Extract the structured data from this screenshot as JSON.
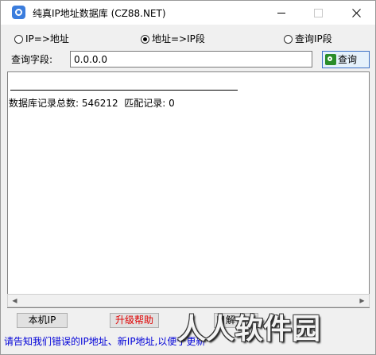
{
  "window": {
    "title": "纯真IP地址数据库  (CZ88.NET)",
    "icon": "app-search-icon"
  },
  "modes": [
    {
      "label": "IP=>地址",
      "checked": false
    },
    {
      "label": "地址=>IP段",
      "checked": true
    },
    {
      "label": "查询IP段",
      "checked": false
    }
  ],
  "query": {
    "label": "查询字段:",
    "value": "0.0.0.0",
    "button_label": "查询"
  },
  "result": {
    "summary": "数据库记录总数: 546212  匹配记录: 0"
  },
  "buttons": {
    "local_ip": "本机IP",
    "upgrade_help": "升级帮助",
    "explain": "解"
  },
  "status": {
    "link_text": "请告知我们错误的IP地址、新IP地址,以便于更新"
  },
  "watermark": {
    "text": "人人软件园"
  },
  "colors": {
    "link": "#0000d8",
    "upgrade": "#e00000",
    "accent": "#3b7ddd"
  }
}
